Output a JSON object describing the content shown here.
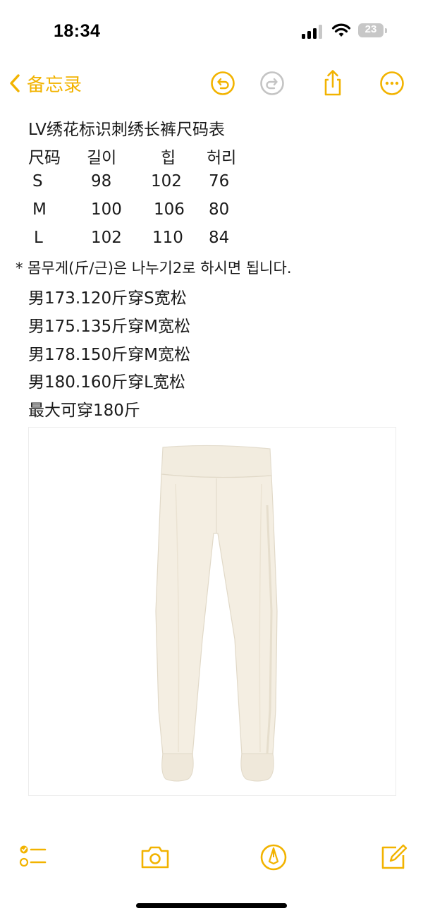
{
  "status_bar": {
    "time": "18:34",
    "battery": "23",
    "icons": [
      "cellular-signal-icon",
      "wifi-icon",
      "battery-icon"
    ]
  },
  "nav": {
    "back_label": "备忘录",
    "icons": [
      "chevron-left-icon",
      "undo-icon",
      "redo-icon",
      "share-icon",
      "more-icon"
    ]
  },
  "note": {
    "title": "LV绣花标识刺绣长裤尺码表",
    "table_header": [
      "尺码",
      "길이",
      "힙",
      "허리"
    ],
    "table_rows": [
      [
        "S",
        "98",
        "102",
        "76"
      ],
      [
        "M",
        "100",
        "106",
        "80"
      ],
      [
        "L",
        "102",
        "110",
        "84"
      ]
    ],
    "note_line": "* 몸무게(斤/근)은 나누기2로 하시면 됩니다.",
    "fit_lines": [
      "男173.120斤穿S宽松",
      "男175.135斤穿M宽松",
      "男178.150斤穿M宽松",
      "男180.160斤穿L宽松",
      "最大可穿180斤"
    ]
  },
  "toolbar": {
    "icons": [
      "checklist-icon",
      "camera-icon",
      "markup-pen-icon",
      "compose-icon"
    ]
  },
  "colors": {
    "accent": "#F2B300",
    "pants": "#F4EEE2",
    "text": "#1A1A1A"
  }
}
